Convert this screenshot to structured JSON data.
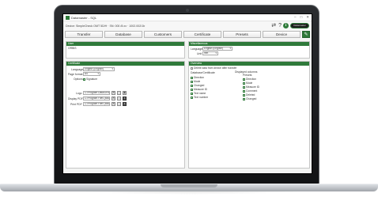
{
  "titlebar": {
    "title": "Datamaster - SQL",
    "minimize": "–",
    "maximize": "□",
    "close": "✕"
  },
  "infobar": {
    "device": "Device: SimpleCheck OMT 5D/H · SN: 000 /8.xx · 1002.002/1b",
    "brand": "Datamaster"
  },
  "tabs": [
    "Transfer",
    "Database",
    "Customers",
    "Certificate",
    "Presets",
    "Device"
  ],
  "tab_edit_icon": "✎",
  "user_panel": {
    "header": "User",
    "value": "ORBIS"
  },
  "misc_panel": {
    "header": "Miscellaneous",
    "language_label": "Language",
    "language_value": "English (English)",
    "unit_label": "Unit",
    "unit_value": "mm"
  },
  "cert_panel": {
    "header": "Certificate",
    "language_label": "Language",
    "language_value": "English (English)",
    "page_format_label": "Page format",
    "page_format_value": "A4",
    "options_label": "Options",
    "options_value": "Signature",
    "logo_label": "Logo",
    "logo_path": "C:\\Program Data\\ORBIS\\logo.bmp",
    "display_pdf_label": "Display PDF",
    "display_pdf_path": "C:\\Program Files (x86)\\Adobe\\...",
    "print_pdf_label": "Print PDF",
    "print_pdf_path": "C:\\Program Files (x86)\\Adobe\\..."
  },
  "overview_panel": {
    "header": "Overview",
    "delete_label": "Delete data from device after transfer",
    "col1_header": "Database/Certificate",
    "col2_header": "Displayed columns",
    "col3_header": "Presets",
    "col1_items": [
      "Direction",
      "Mode",
      "Changed",
      "Measure ID",
      "Text name",
      "Text number"
    ],
    "col3_items": [
      "Direction",
      "Mode",
      "Measure ID",
      "Comment",
      "Deleted",
      "Changed"
    ]
  }
}
